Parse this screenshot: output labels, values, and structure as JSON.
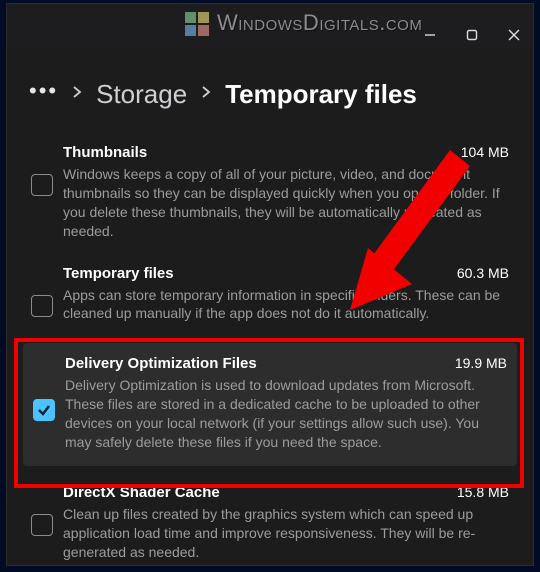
{
  "watermark": "WindowsDigitals.com",
  "breadcrumb": {
    "storage": "Storage",
    "current": "Temporary files"
  },
  "items": [
    {
      "title": "Thumbnails",
      "size": "104 MB",
      "desc": "Windows keeps a copy of all of your picture, video, and document thumbnails so they can be displayed quickly when you open a folder. If you delete these thumbnails, they will be automatically recreated as needed.",
      "checked": false
    },
    {
      "title": "Temporary files",
      "size": "60.3 MB",
      "desc": "Apps can store temporary information in specific folders. These can be cleaned up manually if the app does not do it automatically.",
      "checked": false
    },
    {
      "title": "Delivery Optimization Files",
      "size": "19.9 MB",
      "desc": "Delivery Optimization is used to download updates from Microsoft. These files are stored in a dedicated cache to be uploaded to other devices on your local network (if your settings allow such use). You may safely delete these files if you need the space.",
      "checked": true
    },
    {
      "title": "DirectX Shader Cache",
      "size": "15.8 MB",
      "desc": "Clean up files created by the graphics system which can speed up application load time and improve responsiveness. They will be re-generated as needed.",
      "checked": false
    }
  ],
  "annot": {
    "arrow_color": "#f20000"
  }
}
